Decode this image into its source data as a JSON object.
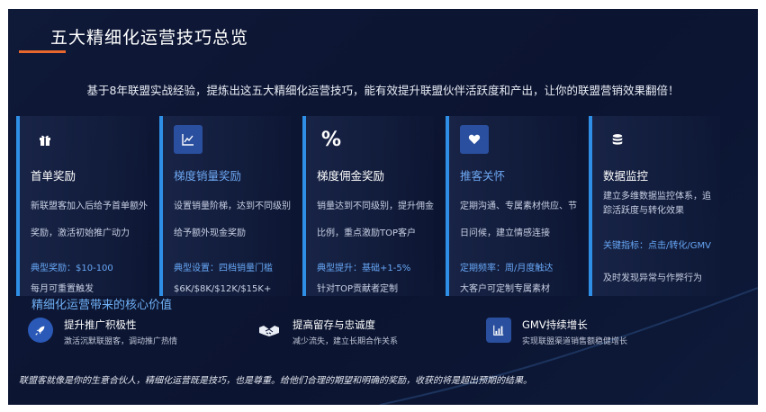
{
  "title": "五大精细化运营技巧总览",
  "subtitle": "基于8年联盟实战经验，提炼出这五大精细化运营技巧，能有效提升联盟伙伴活跃度和产出，让你的联盟营销效果翻倍！",
  "cards": [
    {
      "icon": "gift-icon",
      "title": "首单奖励",
      "desc": "新联盟客加入后给予首单额外奖励，激活初始推广动力",
      "key": "典型奖励：$10-100",
      "extra": "每月可重置触发"
    },
    {
      "icon": "chart-line-icon",
      "title": "梯度销量奖励",
      "desc": "设置销量阶梯，达到不同级别给予额外现金奖励",
      "key": "典型设置：四档销量门槛",
      "extra": "$6K/$8K/$12K/$15K+"
    },
    {
      "icon": "percent-icon",
      "icon_text": "%",
      "title": "梯度佣金奖励",
      "desc": "销量达到不同级别，提升佣金比例，重点激励TOP客户",
      "key": "典型提升：基础+1-5%",
      "extra": "针对TOP贡献者定制"
    },
    {
      "icon": "heart-icon",
      "title": "推客关怀",
      "desc": "定期沟通、专属素材供应、节日问候，建立情感连接",
      "key": "定期频率：周/月度触达",
      "extra": "大客户可定制专属素材"
    },
    {
      "icon": "database-icon",
      "title": "数据监控",
      "desc": "建立多维数据监控体系，追 踪活跃度与转化效果",
      "key": "关键指标：点击/转化/GMV",
      "extra": "及时发现异常与作弊行为"
    }
  ],
  "value_section": {
    "title": "精细化运营带来的核心价值",
    "items": [
      {
        "icon": "rocket-icon",
        "label": "提升推广积极性",
        "desc": "激活沉默联盟客，调动推广热情"
      },
      {
        "icon": "handshake-icon",
        "label": "提高留存与忠诚度",
        "desc": "减少流失，建立长期合作关系"
      },
      {
        "icon": "growth-chart-icon",
        "label": "GMV持续增长",
        "desc": "实现联盟渠道销售额稳健增长"
      }
    ]
  },
  "quote": "联盟客就像是你的生意合伙人，精细化运营既是技巧，也是尊重。给他们合理的期望和明确的奖励，收获的将是超出预期的结果。",
  "colors": {
    "accent": "#2f8fe6",
    "title_underline": "#e8672c",
    "background": "#0f1938",
    "highlight_text": "#67a7f5"
  }
}
